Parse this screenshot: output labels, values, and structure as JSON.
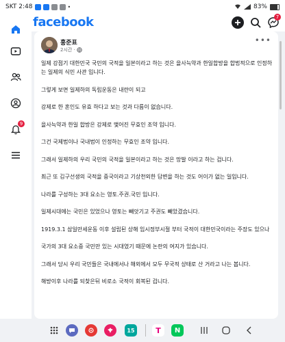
{
  "status_bar": {
    "carrier_time": "SKT 2:48",
    "battery": "83%",
    "battery_level": 0.83
  },
  "header": {
    "logo": "facebook",
    "messenger_badge": "7"
  },
  "sidebar": {
    "notifications_badge": "9",
    "items": [
      {
        "icon": "home-icon"
      },
      {
        "icon": "video-icon"
      },
      {
        "icon": "friends-icon"
      },
      {
        "icon": "profile-icon"
      },
      {
        "icon": "notifications-bell-icon"
      },
      {
        "icon": "menu-icon"
      }
    ]
  },
  "post": {
    "author": "홍준표",
    "time": "2시간",
    "paragraphs": [
      "일제 강점기 대한민국 국민의 국적을 일본이라고 하는 것은 을사늑약과 한일합방을 합법적으로 인정하는 일제의 식민 사관 입니다.",
      "그렇게 보면 일제하의 독립운동은 내란이 되고",
      "강제로 한 혼인도 유효 하다고 보는 것과 다름이 없습니다.",
      "을사늑약과 한일 합방은 강제로 맺어진 무효인 조약 입니다.",
      "그건 국제법이나 국내법이 인정하는 무효인 조약 입니다.",
      "그래서 일제하의 우리 국민의 국적을 일본이라고 하는 것은 망발 이라고 하는 겁니다.",
      "최근 또 김구선생의 국적을 중국이라고 기상천외한 답변을 하는 것도 어이가 없는 일입니다.",
      "나라를 구성하는 3대 요소는 영토.주권.국민 입니다.",
      "일제시대에는 국민은 있었으나 영토는 빼앗기고 주권도 빼았겼습니다.",
      "1919.3.1 삼일만세운동 이후 설립된 상해 임시정부시절 부터 국적이 대한민국이라는 주장도 있으나",
      "국가의 3대 요소중 국민만 있는 시대였기 때문에 논란의 여지가 있습니다.",
      "그래서 당시 우리 국민들은 국내에서나 해외에서 모두 무국적 상태로 산 거라고 나는 봅니다.",
      "해방이후 나라를 되찾은뒤 비로소 국적이 회복된 겁니다."
    ]
  },
  "dock": {
    "apps": [
      {
        "icon": "app-grid-icon",
        "label": ""
      },
      {
        "icon": "chat-app-icon",
        "label": ""
      },
      {
        "icon": "camera-app-icon",
        "label": ""
      },
      {
        "icon": "gallery-app-icon",
        "label": ""
      },
      {
        "icon": "calendar-app-icon",
        "label": "15"
      },
      {
        "icon": "t-app-icon",
        "label": "T"
      },
      {
        "icon": "naver-app-icon",
        "label": "N"
      }
    ]
  },
  "colors": {
    "brand": "#1877f2",
    "badge": "#e41e3f"
  }
}
